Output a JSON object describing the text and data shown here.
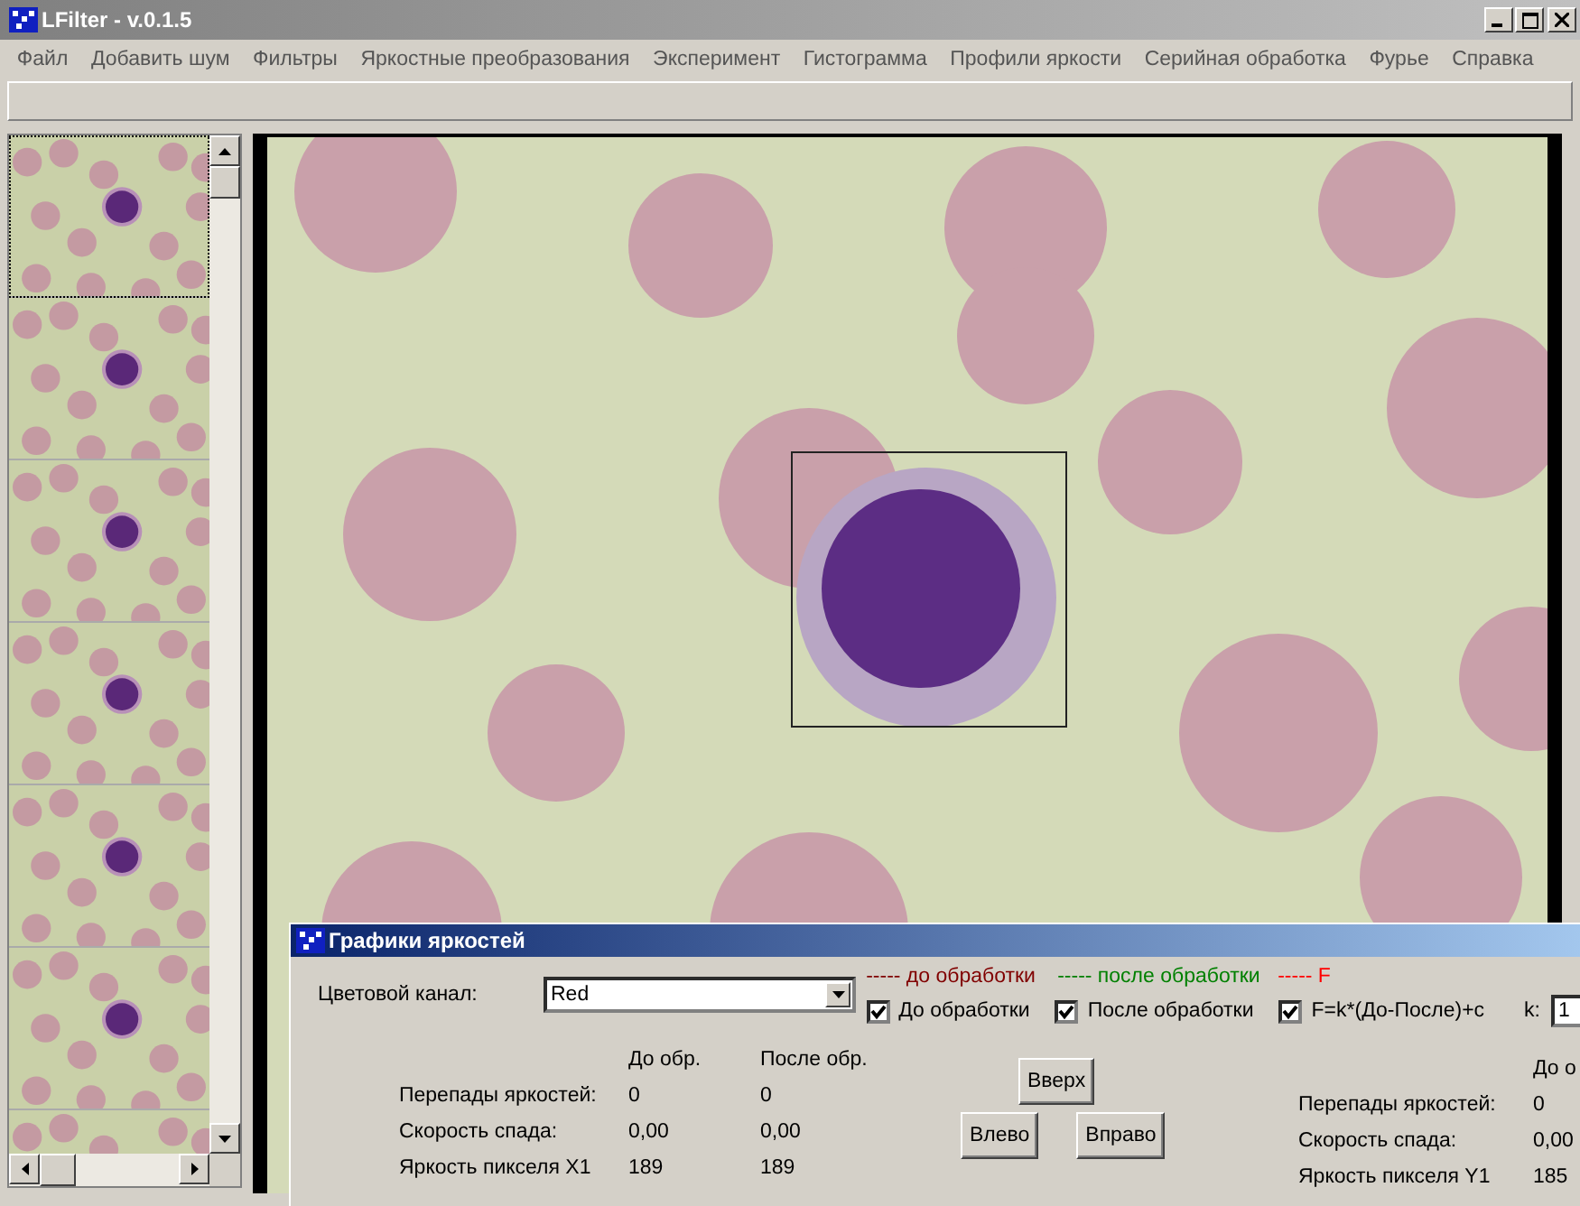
{
  "window": {
    "title": "LFilter - v.0.1.5"
  },
  "menu": [
    "Файл",
    "Добавить шум",
    "Фильтры",
    "Яркостные преобразования",
    "Эксперимент",
    "Гистограмма",
    "Профили яркости",
    "Серийная обработка",
    "Фурье",
    "Справка"
  ],
  "thumbnails": [
    {
      "selected": true
    },
    {
      "selected": false
    },
    {
      "selected": false
    },
    {
      "selected": false
    },
    {
      "selected": false
    },
    {
      "selected": false
    },
    {
      "selected": false
    }
  ],
  "dialog": {
    "title": "Графики яркостей",
    "channel_label": "Цветовой канал:",
    "channel_value": "Red",
    "legend": [
      {
        "text": "----- до обработки",
        "color": "#800000"
      },
      {
        "text": "----- после обработки",
        "color": "#008000"
      },
      {
        "text": "-----  F",
        "color": "#ff0000"
      }
    ],
    "checkboxes": [
      {
        "label": "До обработки",
        "checked": true
      },
      {
        "label": "После обработки",
        "checked": true
      },
      {
        "label": "F=k*(До-После)+c",
        "checked": true
      }
    ],
    "k_label": "k:",
    "k_value": "1",
    "x_table": {
      "columns": [
        "До обр.",
        "После обр."
      ],
      "rows": [
        {
          "label": "Перепады яркостей:",
          "before": "0",
          "after": "0"
        },
        {
          "label": "Скорость спада:",
          "before": "0,00",
          "after": "0,00"
        },
        {
          "label": "Яркость пикселя X1",
          "before": "189",
          "after": "189"
        }
      ]
    },
    "buttons": [
      "Вверх",
      "Влево",
      "Вправо"
    ],
    "y_table": {
      "columns": [
        "До о"
      ],
      "rows": [
        {
          "label": "Перепады яркостей:",
          "before": "0"
        },
        {
          "label": "Скорость спада:",
          "before": "0,00"
        },
        {
          "label": "Яркость пикселя Y1",
          "before": "185"
        }
      ]
    }
  }
}
